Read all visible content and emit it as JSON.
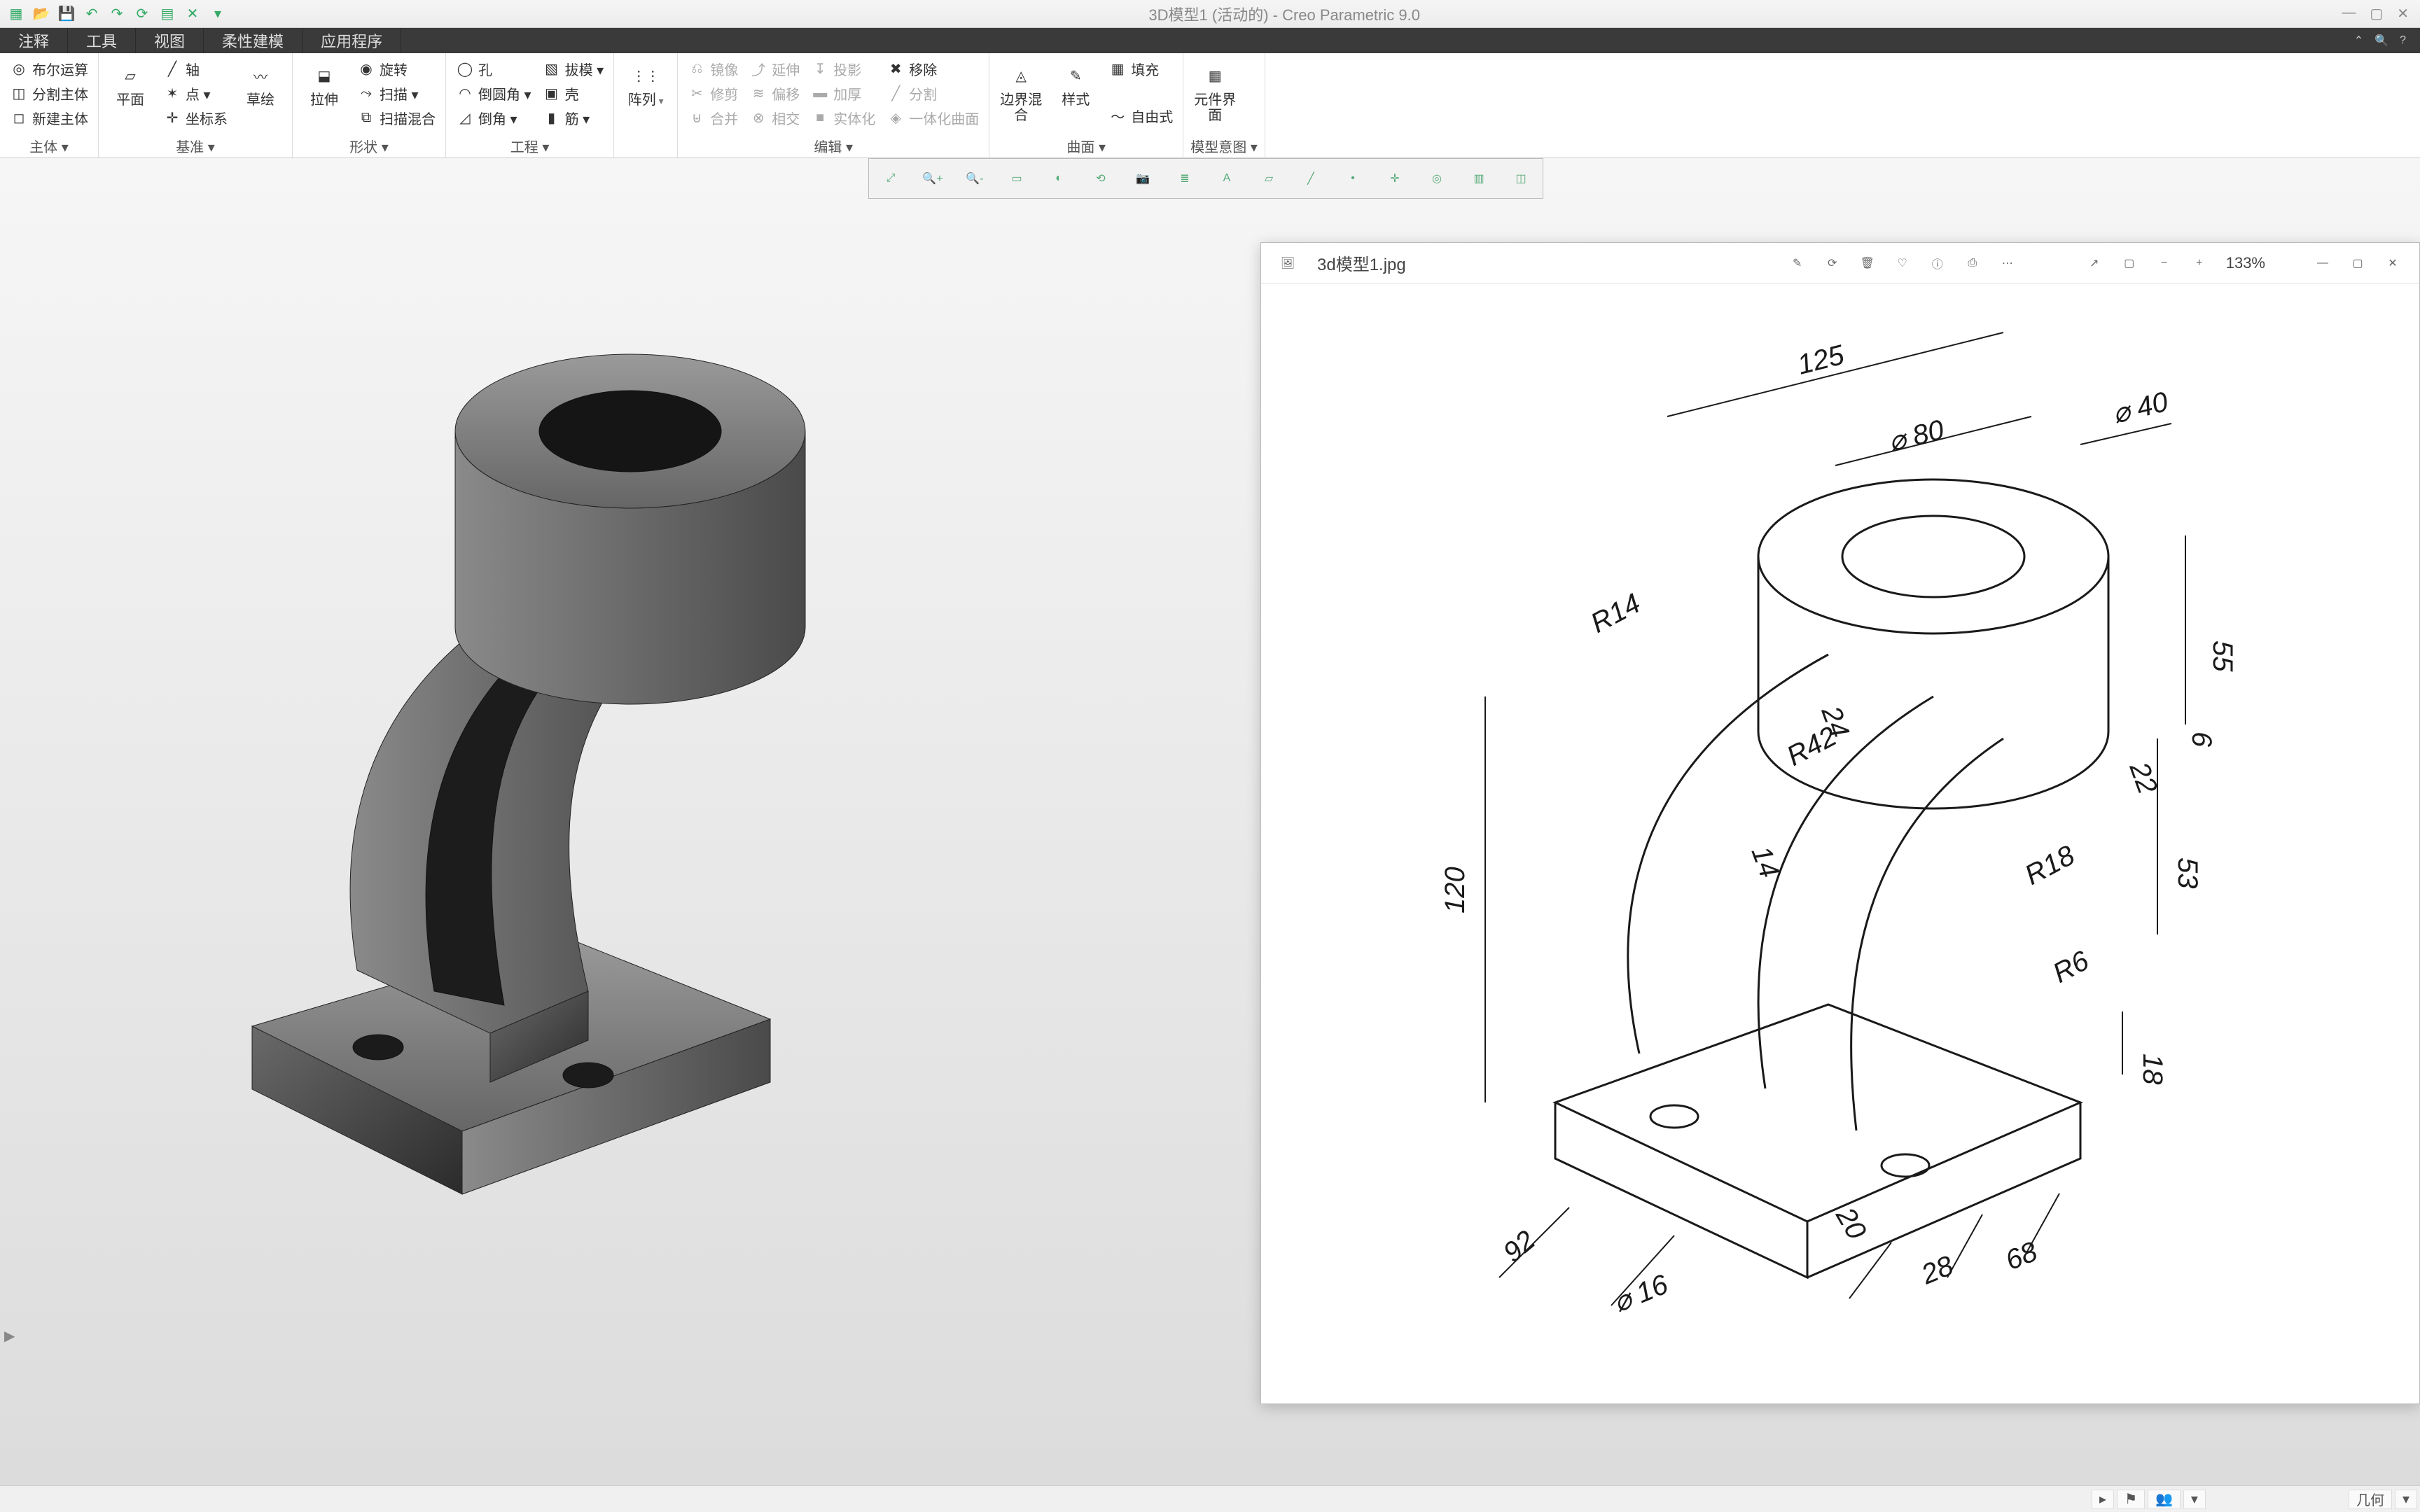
{
  "app": {
    "title_doc": "3D模型1 (活动的)",
    "title_app": "Creo Parametric 9.0"
  },
  "qat": [
    "new",
    "open",
    "save",
    "undo",
    "redo",
    "regen",
    "windows",
    "close"
  ],
  "tabs": [
    {
      "label": "注释"
    },
    {
      "label": "工具"
    },
    {
      "label": "视图"
    },
    {
      "label": "柔性建模"
    },
    {
      "label": "应用程序"
    }
  ],
  "ribbon": {
    "g_body": {
      "label": "主体 ▾",
      "items": [
        {
          "label": "布尔运算"
        },
        {
          "label": "分割主体"
        },
        {
          "label": "新建主体"
        }
      ]
    },
    "g_datum": {
      "label": "基准 ▾",
      "big": [
        {
          "label": "平面"
        },
        {
          "label": "草绘"
        }
      ],
      "items": [
        {
          "label": "轴"
        },
        {
          "label": "点 ▾"
        },
        {
          "label": "坐标系"
        }
      ]
    },
    "g_shape": {
      "label": "形状 ▾",
      "big": [
        {
          "label": "拉伸"
        }
      ],
      "items": [
        {
          "label": "旋转"
        },
        {
          "label": "扫描 ▾"
        },
        {
          "label": "扫描混合"
        }
      ]
    },
    "g_eng": {
      "label": "工程 ▾",
      "items": [
        {
          "label": "孔"
        },
        {
          "label": "倒圆角 ▾"
        },
        {
          "label": "倒角 ▾"
        },
        {
          "label": "拔模 ▾"
        },
        {
          "label": "壳"
        },
        {
          "label": "筋 ▾"
        }
      ]
    },
    "g_pattern": {
      "label": "",
      "big": [
        {
          "label": "阵列"
        }
      ]
    },
    "g_edit": {
      "label": "编辑 ▾",
      "items": [
        {
          "label": "镜像",
          "d": true
        },
        {
          "label": "延伸",
          "d": true
        },
        {
          "label": "投影",
          "d": true
        },
        {
          "label": "移除",
          "d": false
        },
        {
          "label": "修剪",
          "d": true
        },
        {
          "label": "偏移",
          "d": true
        },
        {
          "label": "加厚",
          "d": true
        },
        {
          "label": "分割",
          "d": true
        },
        {
          "label": "合并",
          "d": true
        },
        {
          "label": "相交",
          "d": true
        },
        {
          "label": "实体化",
          "d": true
        },
        {
          "label": "一体化曲面",
          "d": true
        }
      ]
    },
    "g_surf": {
      "label": "曲面 ▾",
      "big": [
        {
          "label": "边界混合"
        },
        {
          "label": "样式"
        }
      ],
      "items": [
        {
          "label": "填充"
        },
        {
          "label": "",
          "d": true
        },
        {
          "label": "自由式"
        }
      ]
    },
    "g_intent": {
      "label": "模型意图 ▾",
      "big": [
        {
          "label": "元件界面"
        }
      ]
    }
  },
  "view_toolbar": [
    "refit",
    "zoom-in",
    "zoom-out",
    "zoom-area",
    "shade",
    "repaint",
    "saved-views",
    "layers",
    "annot",
    "datum-plane",
    "datum-axis",
    "datum-point",
    "datum-csys",
    "spin",
    "clip",
    "perspective"
  ],
  "tree_stub": "▶",
  "viewer": {
    "filename": "3d模型1.jpg",
    "zoom": "133%",
    "buttons": [
      "edit",
      "rotate",
      "delete",
      "favorite",
      "info",
      "share",
      "more",
      "open-with",
      "slideshow",
      "zoom-out",
      "zoom-in"
    ],
    "win": [
      "min",
      "max",
      "close"
    ]
  },
  "drawing_dims": {
    "d125": "125",
    "phi80": "⌀ 80",
    "phi40": "⌀ 40",
    "r14": "R14",
    "d24": "24",
    "r42": "R42",
    "d14": "14",
    "d120": "120",
    "d55": "55",
    "d6": "6",
    "d22": "22",
    "d53": "53",
    "r18": "R18",
    "r6": "R6",
    "d18": "18",
    "d92": "92",
    "phi16": "⌀ 16",
    "d20": "20",
    "d28": "28",
    "d68": "68"
  },
  "status": {
    "right_label": "几何"
  }
}
